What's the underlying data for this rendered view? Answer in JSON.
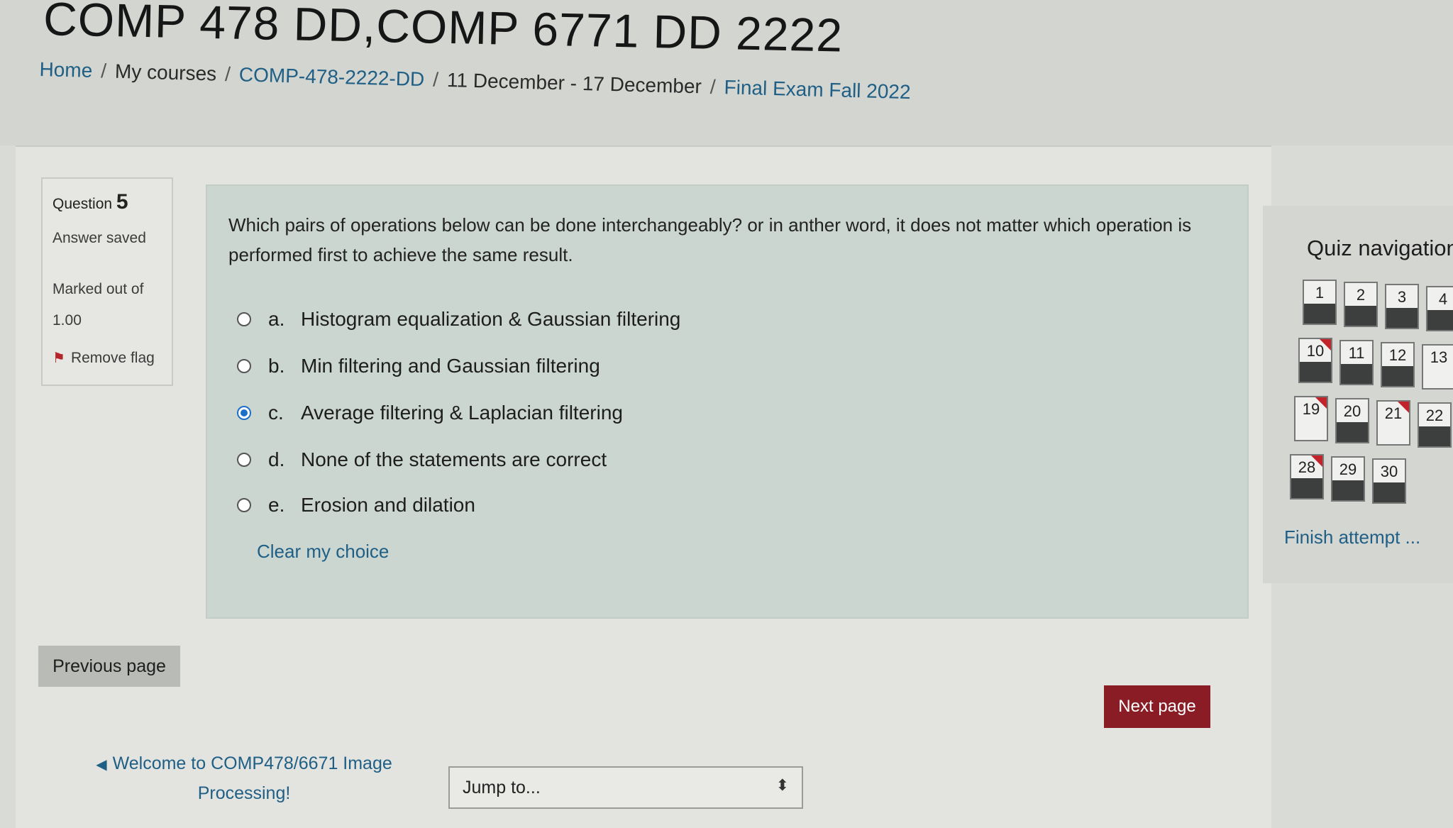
{
  "header": {
    "course_title": "COMP 478 DD,COMP 6771 DD 2222",
    "breadcrumb": [
      {
        "label": "Home"
      },
      {
        "label": "My courses"
      },
      {
        "label": "COMP-478-2222-DD"
      },
      {
        "label": "11 December - 17 December"
      },
      {
        "label": "Final Exam Fall 2022"
      }
    ],
    "separator": "/"
  },
  "question_info": {
    "label": "Question",
    "number": "5",
    "state": "Answer saved",
    "mark_label": "Marked out of",
    "mark_value": "1.00",
    "flag_label": "Remove flag"
  },
  "question": {
    "text": "Which pairs of operations below can be done interchangeably? or in anther word, it does not matter which operation is performed first to achieve the same result.",
    "options": [
      {
        "letter": "a.",
        "text": "Histogram equalization & Gaussian filtering",
        "selected": false
      },
      {
        "letter": "b.",
        "text": "Min filtering and Gaussian filtering",
        "selected": false
      },
      {
        "letter": "c.",
        "text": "Average filtering & Laplacian filtering",
        "selected": true
      },
      {
        "letter": "d.",
        "text": "None of the statements are correct",
        "selected": false
      },
      {
        "letter": "e.",
        "text": "Erosion and dilation",
        "selected": false
      }
    ],
    "clear_choice": "Clear my choice"
  },
  "buttons": {
    "previous": "Previous page",
    "next": "Next page"
  },
  "footer": {
    "back_link": "Welcome to COMP478/6671 Image Processing!",
    "jump_to": "Jump to..."
  },
  "quiz_nav": {
    "title": "Quiz navigation",
    "finish": "Finish attempt ...",
    "buttons": [
      {
        "num": "1",
        "answered": true,
        "flagged": false
      },
      {
        "num": "2",
        "answered": true,
        "flagged": false
      },
      {
        "num": "3",
        "answered": true,
        "flagged": false
      },
      {
        "num": "4",
        "answered": true,
        "flagged": false
      },
      {
        "num": "10",
        "answered": true,
        "flagged": true
      },
      {
        "num": "11",
        "answered": true,
        "flagged": false
      },
      {
        "num": "12",
        "answered": true,
        "flagged": false
      },
      {
        "num": "13",
        "answered": false,
        "flagged": false
      },
      {
        "num": "19",
        "answered": false,
        "flagged": true
      },
      {
        "num": "20",
        "answered": true,
        "flagged": false
      },
      {
        "num": "21",
        "answered": false,
        "flagged": true
      },
      {
        "num": "22",
        "answered": true,
        "flagged": false
      },
      {
        "num": "28",
        "answered": true,
        "flagged": true
      },
      {
        "num": "29",
        "answered": true,
        "flagged": false
      },
      {
        "num": "30",
        "answered": true,
        "flagged": false
      }
    ]
  },
  "colors": {
    "link": "#1f5f85",
    "next_button": "#8a1c26",
    "flag": "#c2242c",
    "radio_selected": "#1c6fc9",
    "formulation_bg": "#cbd6d0"
  }
}
